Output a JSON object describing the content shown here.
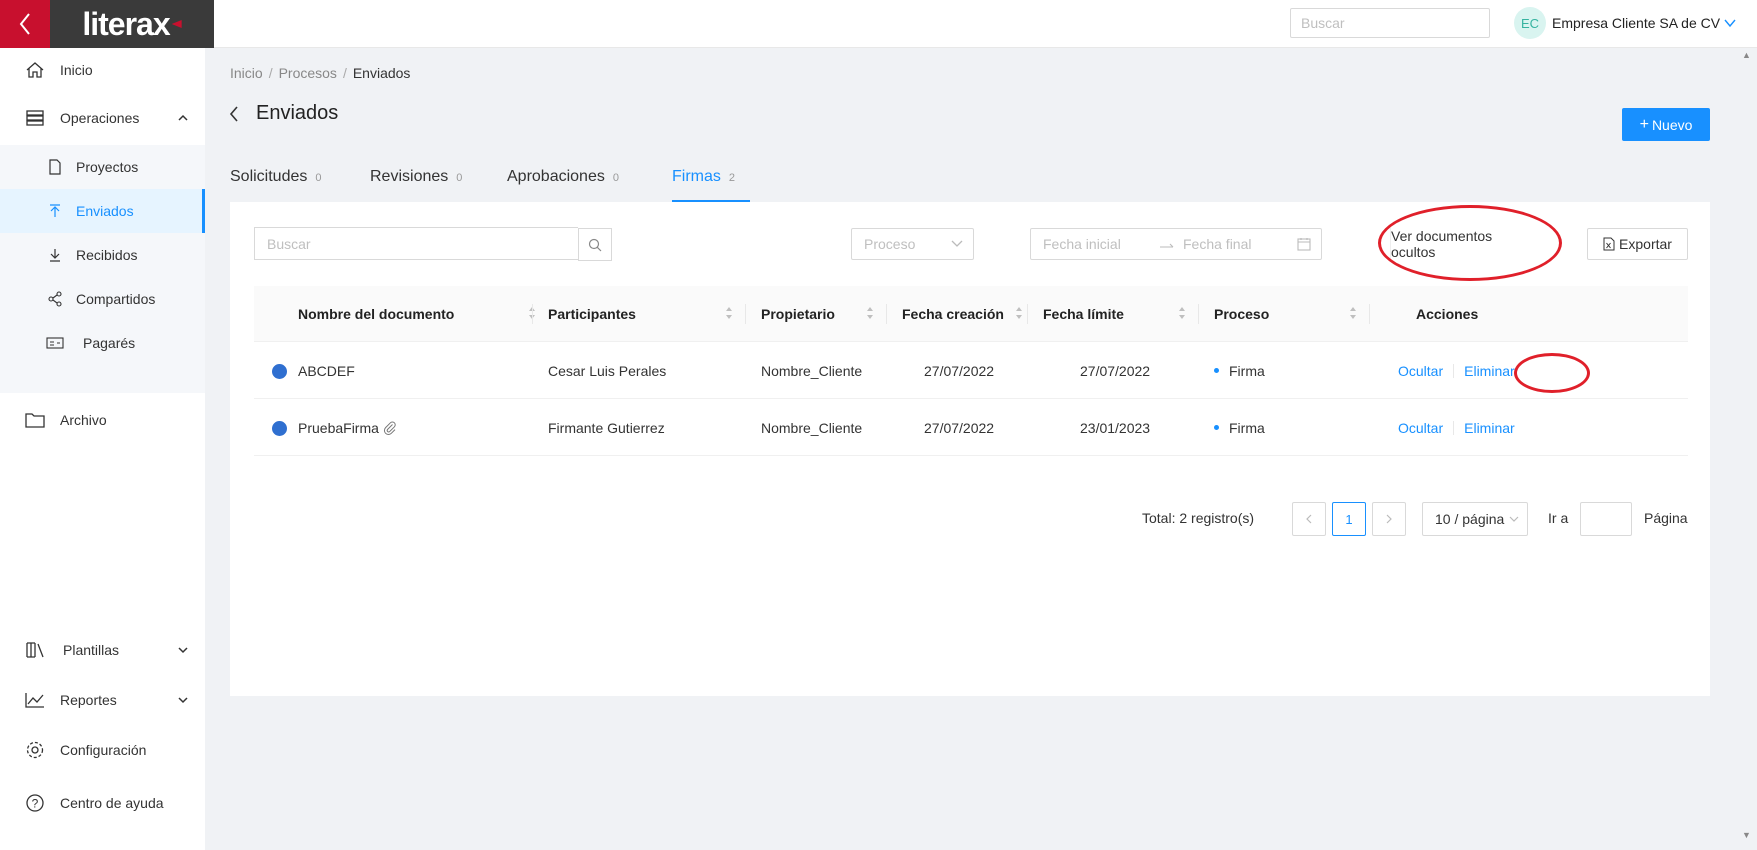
{
  "brand": {
    "name": "literax",
    "accent": "#c8102e"
  },
  "topbar": {
    "search_placeholder": "Buscar",
    "user_initials": "EC",
    "user_name": "Empresa Cliente SA de CV"
  },
  "sidebar": {
    "inicio": "Inicio",
    "operaciones": "Operaciones",
    "proyectos": "Proyectos",
    "enviados": "Enviados",
    "recibidos": "Recibidos",
    "compartidos": "Compartidos",
    "pagares": "Pagarés",
    "archivo": "Archivo",
    "plantillas": "Plantillas",
    "reportes": "Reportes",
    "configuracion": "Configuración",
    "centro_ayuda": "Centro de ayuda"
  },
  "breadcrumb": {
    "items": [
      "Inicio",
      "Procesos",
      "Enviados"
    ]
  },
  "page": {
    "title": "Enviados",
    "new_button": "Nuevo"
  },
  "tabs": [
    {
      "label": "Solicitudes",
      "count": "0"
    },
    {
      "label": "Revisiones",
      "count": "0"
    },
    {
      "label": "Aprobaciones",
      "count": "0"
    },
    {
      "label": "Firmas",
      "count": "2"
    }
  ],
  "filters": {
    "search_placeholder": "Buscar",
    "process_placeholder": "Proceso",
    "date_start_placeholder": "Fecha inicial",
    "date_end_placeholder": "Fecha final",
    "hidden_docs_button": "Ver documentos ocultos",
    "export_button": "Exportar"
  },
  "table": {
    "columns": [
      "Nombre del documento",
      "Participantes",
      "Propietario",
      "Fecha creación",
      "Fecha límite",
      "Proceso",
      "Acciones"
    ],
    "rows": [
      {
        "name": "ABCDEF",
        "participants": "Cesar Luis Perales",
        "owner": "Nombre_Cliente",
        "created": "27/07/2022",
        "deadline": "27/07/2022",
        "process": "Firma",
        "action_hide": "Ocultar",
        "action_delete": "Eliminar"
      },
      {
        "name": "PruebaFirma",
        "participants": "Firmante Gutierrez",
        "owner": "Nombre_Cliente",
        "created": "27/07/2022",
        "deadline": "23/01/2023",
        "process": "Firma",
        "action_hide": "Ocultar",
        "action_delete": "Eliminar"
      }
    ]
  },
  "pagination": {
    "total": "Total: 2 registro(s)",
    "current_page": "1",
    "page_size": "10 / página",
    "goto_label": "Ir a",
    "page_label": "Página"
  },
  "colors": {
    "primary": "#1890ff",
    "annotation": "#e0202a",
    "status_dot": "#2f6fd0"
  }
}
